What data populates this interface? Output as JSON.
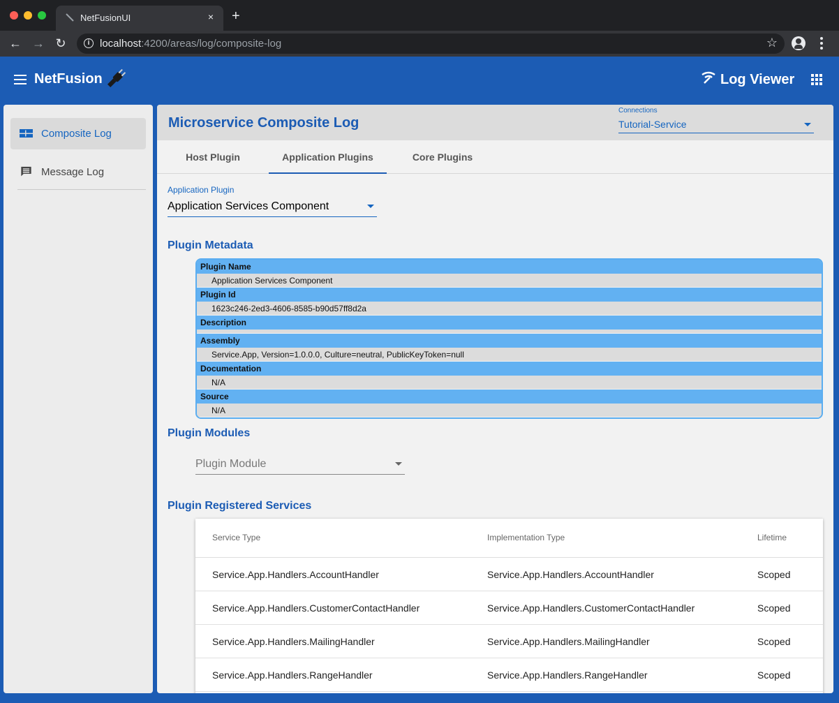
{
  "browser": {
    "tab_title": "NetFusionUI",
    "tab_close": "×",
    "new_tab": "+",
    "url_host": "localhost",
    "url_rest": ":4200/areas/log/composite-log",
    "info_glyph": "i",
    "star_glyph": "☆",
    "back_glyph": "←",
    "forward_glyph": "→",
    "reload_glyph": "↻"
  },
  "toolbar": {
    "brand": "NetFusion",
    "right_title": "Log Viewer",
    "color": "#1c5cb4"
  },
  "sidenav": {
    "items": [
      {
        "label": "Composite Log",
        "icon": "view-quilt-icon",
        "active": true
      },
      {
        "label": "Message Log",
        "icon": "message-icon",
        "active": false
      }
    ]
  },
  "main": {
    "title": "Microservice Composite Log",
    "connections": {
      "label": "Connections",
      "value": "Tutorial-Service"
    },
    "tabs": [
      {
        "label": "Host Plugin"
      },
      {
        "label": "Application Plugins",
        "active": true
      },
      {
        "label": "Core Plugins"
      }
    ],
    "application_plugin": {
      "label": "Application Plugin",
      "value": "Application Services Component"
    },
    "metadata_title": "Plugin Metadata",
    "metadata": [
      {
        "key": "Plugin Name",
        "value": "Application Services Component"
      },
      {
        "key": "Plugin Id",
        "value": "1623c246-2ed3-4606-8585-b90d57ff8d2a"
      },
      {
        "key": "Description",
        "value": ""
      },
      {
        "key": "Assembly",
        "value": "Service.App, Version=1.0.0.0, Culture=neutral, PublicKeyToken=null"
      },
      {
        "key": "Documentation",
        "value": "N/A"
      },
      {
        "key": "Source",
        "value": "N/A"
      }
    ],
    "modules_title": "Plugin Modules",
    "module_placeholder": "Plugin Module",
    "services_title": "Plugin Registered Services",
    "services_columns": [
      "Service Type",
      "Implementation Type",
      "Lifetime"
    ],
    "services": [
      [
        "Service.App.Handlers.AccountHandler",
        "Service.App.Handlers.AccountHandler",
        "Scoped"
      ],
      [
        "Service.App.Handlers.CustomerContactHandler",
        "Service.App.Handlers.CustomerContactHandler",
        "Scoped"
      ],
      [
        "Service.App.Handlers.MailingHandler",
        "Service.App.Handlers.MailingHandler",
        "Scoped"
      ],
      [
        "Service.App.Handlers.RangeHandler",
        "Service.App.Handlers.RangeHandler",
        "Scoped"
      ]
    ]
  }
}
